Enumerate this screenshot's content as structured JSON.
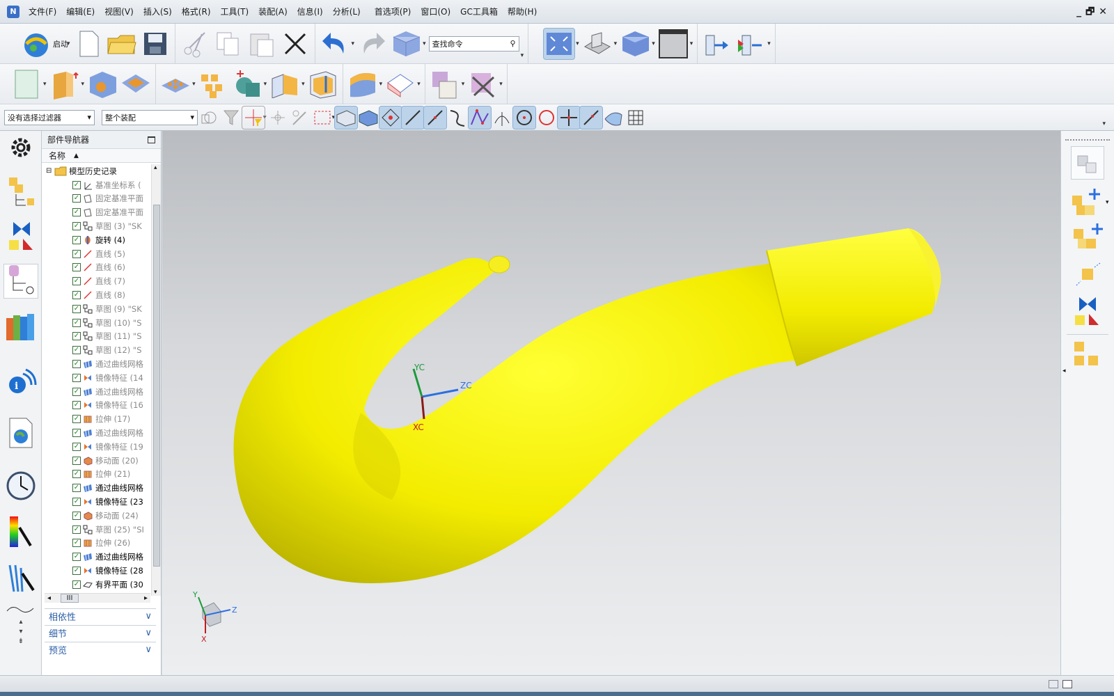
{
  "menu": {
    "items": [
      "文件(F)",
      "编辑(E)",
      "视图(V)",
      "插入(S)",
      "格式(R)",
      "工具(T)",
      "装配(A)",
      "信息(I)",
      "分析(L)",
      "首选项(P)",
      "窗口(O)",
      "GC工具箱",
      "帮助(H)"
    ],
    "window_controls": [
      "_",
      "🗗",
      "✕"
    ]
  },
  "toolbar": {
    "start_label": "启动",
    "search_placeholder": "查找命令",
    "selection_filter": "没有选择过滤器",
    "assembly_scope": "整个装配"
  },
  "navigator": {
    "title": "部件导航器",
    "column_name": "名称",
    "root": "模型历史记录",
    "items": [
      {
        "label": "基准坐标系 (",
        "icon": "datum-csys-icon",
        "dim": true
      },
      {
        "label": "固定基准平面",
        "icon": "datum-plane-icon",
        "dim": true
      },
      {
        "label": "固定基准平面",
        "icon": "datum-plane-icon",
        "dim": true
      },
      {
        "label": "草图 (3) \"SK",
        "icon": "sketch-icon",
        "dim": true
      },
      {
        "label": "旋转 (4)",
        "icon": "revolve-icon",
        "dim": false
      },
      {
        "label": "直线 (5)",
        "icon": "line-icon",
        "dim": true
      },
      {
        "label": "直线 (6)",
        "icon": "line-icon",
        "dim": true
      },
      {
        "label": "直线 (7)",
        "icon": "line-icon",
        "dim": true
      },
      {
        "label": "直线 (8)",
        "icon": "line-icon",
        "dim": true
      },
      {
        "label": "草图 (9) \"SK",
        "icon": "sketch-icon",
        "dim": true
      },
      {
        "label": "草图 (10) \"S",
        "icon": "sketch-icon",
        "dim": true
      },
      {
        "label": "草图 (11) \"S",
        "icon": "sketch-icon",
        "dim": true
      },
      {
        "label": "草图 (12) \"S",
        "icon": "sketch-icon",
        "dim": true
      },
      {
        "label": "通过曲线网格",
        "icon": "mesh-surface-icon",
        "dim": true
      },
      {
        "label": "镜像特征 (14",
        "icon": "mirror-feature-icon",
        "dim": true
      },
      {
        "label": "通过曲线网格",
        "icon": "mesh-surface-icon",
        "dim": true
      },
      {
        "label": "镜像特征 (16",
        "icon": "mirror-feature-icon",
        "dim": true
      },
      {
        "label": "拉伸 (17)",
        "icon": "extrude-icon",
        "dim": true
      },
      {
        "label": "通过曲线网格",
        "icon": "mesh-surface-icon",
        "dim": true
      },
      {
        "label": "镜像特征 (19",
        "icon": "mirror-feature-icon",
        "dim": true
      },
      {
        "label": "移动面 (20)",
        "icon": "move-face-icon",
        "dim": true
      },
      {
        "label": "拉伸 (21)",
        "icon": "extrude-icon",
        "dim": true
      },
      {
        "label": "通过曲线网格",
        "icon": "mesh-surface-icon",
        "dim": false
      },
      {
        "label": "镜像特征 (23",
        "icon": "mirror-feature-icon",
        "dim": false
      },
      {
        "label": "移动面 (24)",
        "icon": "move-face-icon",
        "dim": true
      },
      {
        "label": "草图 (25) \"SI",
        "icon": "sketch-icon",
        "dim": true
      },
      {
        "label": "拉伸 (26)",
        "icon": "extrude-icon",
        "dim": true
      },
      {
        "label": "通过曲线网格",
        "icon": "mesh-surface-icon",
        "dim": false
      },
      {
        "label": "镜像特征 (28",
        "icon": "mirror-feature-icon",
        "dim": false
      },
      {
        "label": "有界平面 (30",
        "icon": "bounded-plane-icon",
        "dim": false
      }
    ],
    "hscroll_label": "III",
    "sections": [
      "相依性",
      "细节",
      "预览"
    ]
  },
  "viewport": {
    "axis_labels": {
      "zc": "ZC",
      "xc": "XC",
      "yc": "YC"
    },
    "triad_labels": {
      "x": "X",
      "y": "Y",
      "z": "Z"
    },
    "model_color": "#f5f000"
  },
  "colors": {
    "accent": "#2d5fa7",
    "checkbox_green": "#1c8a1c"
  }
}
